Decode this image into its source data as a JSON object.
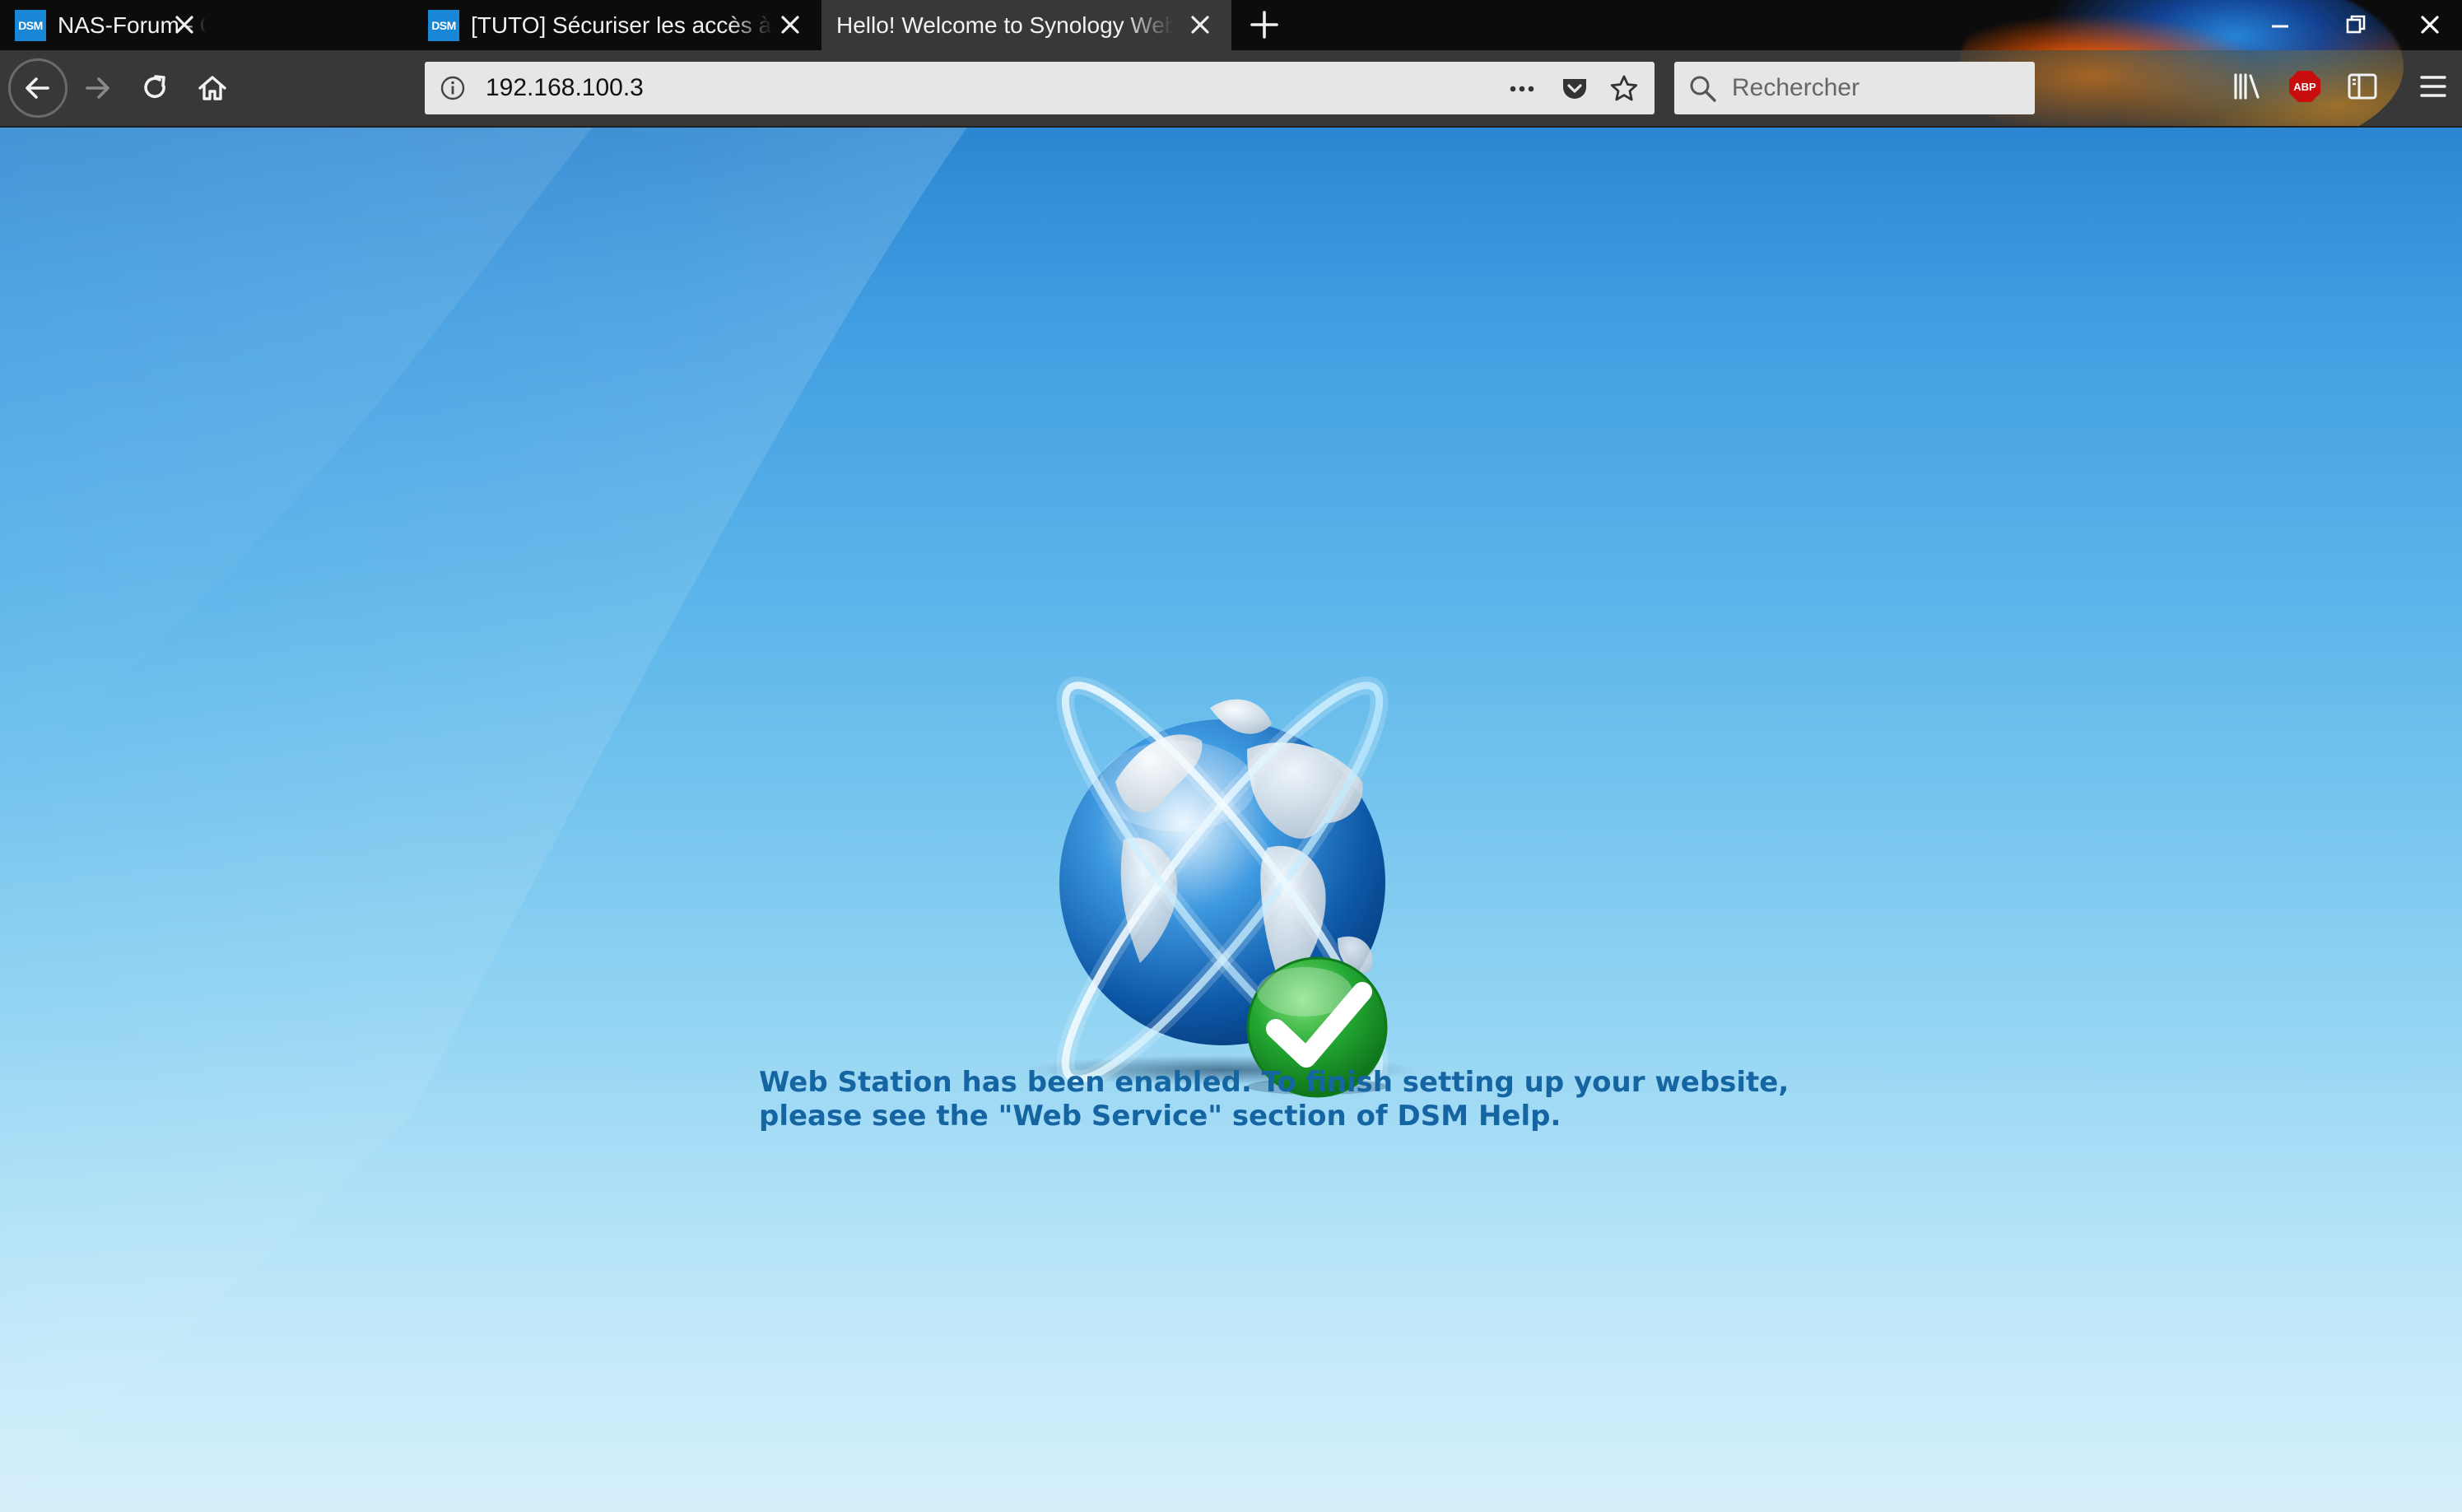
{
  "browser": {
    "tabs": [
      {
        "favicon": "DSM",
        "title": "NAS-Forum - Communauté Française",
        "active": false
      },
      {
        "favicon": "DSM",
        "title": "[TUTO] Sécuriser les accès à son NAS",
        "active": false
      },
      {
        "favicon": "",
        "title": "Hello! Welcome to Synology Web Station!",
        "active": true
      }
    ],
    "url": "192.168.100.3",
    "search_placeholder": "Rechercher",
    "adblock_badge": "ABP",
    "icons": {
      "back": "back-arrow-icon",
      "forward": "forward-arrow-icon",
      "reload": "reload-icon",
      "home": "home-icon",
      "page_actions": "more-dots-icon",
      "pocket": "pocket-icon",
      "bookmark": "star-icon",
      "library": "library-icon",
      "sidebar": "sidebar-icon",
      "menu": "hamburger-menu-icon"
    }
  },
  "page": {
    "message_line1": "Web Station has been enabled. To finish setting up your website,",
    "message_line2": "please see the \"Web Service\" section of DSM Help.",
    "text_color": "#1565a3",
    "check_color": "#22a631"
  }
}
